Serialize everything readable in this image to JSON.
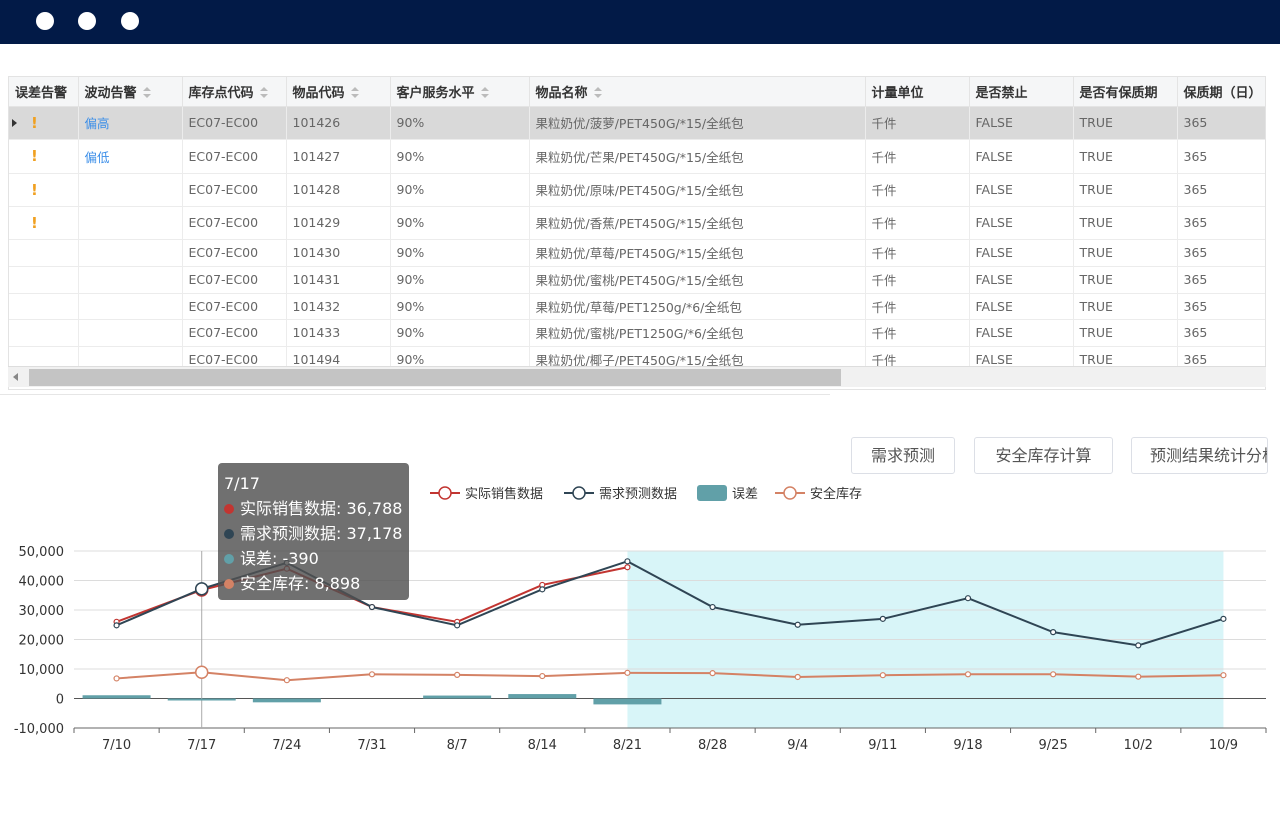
{
  "window": {
    "controls": [
      "circle",
      "circle",
      "circle"
    ]
  },
  "table": {
    "columns": [
      "误差告警",
      "波动告警",
      "库存点代码",
      "物品代码",
      "客户服务水平",
      "物品名称",
      "计量单位",
      "是否禁止",
      "是否有保质期",
      "保质期（日）"
    ],
    "rows": [
      [
        "!",
        "偏高",
        "EC07-EC00",
        "101426",
        "90%",
        "果粒奶优/菠萝/PET450G/*15/全纸包",
        "千件",
        "FALSE",
        "TRUE",
        "365"
      ],
      [
        "!",
        "偏低",
        "EC07-EC00",
        "101427",
        "90%",
        "果粒奶优/芒果/PET450G/*15/全纸包",
        "千件",
        "FALSE",
        "TRUE",
        "365"
      ],
      [
        "!",
        "",
        "EC07-EC00",
        "101428",
        "90%",
        "果粒奶优/原味/PET450G/*15/全纸包",
        "千件",
        "FALSE",
        "TRUE",
        "365"
      ],
      [
        "!",
        "",
        "EC07-EC00",
        "101429",
        "90%",
        "果粒奶优/香蕉/PET450G/*15/全纸包",
        "千件",
        "FALSE",
        "TRUE",
        "365"
      ],
      [
        "",
        "",
        "EC07-EC00",
        "101430",
        "90%",
        "果粒奶优/草莓/PET450G/*15/全纸包",
        "千件",
        "FALSE",
        "TRUE",
        "365"
      ],
      [
        "",
        "",
        "EC07-EC00",
        "101431",
        "90%",
        "果粒奶优/蜜桃/PET450G/*15/全纸包",
        "千件",
        "FALSE",
        "TRUE",
        "365"
      ],
      [
        "",
        "",
        "EC07-EC00",
        "101432",
        "90%",
        "果粒奶优/草莓/PET1250g/*6/全纸包",
        "千件",
        "FALSE",
        "TRUE",
        "365"
      ],
      [
        "",
        "",
        "EC07-EC00",
        "101433",
        "90%",
        "果粒奶优/蜜桃/PET1250G/*6/全纸包",
        "千件",
        "FALSE",
        "TRUE",
        "365"
      ],
      [
        "",
        "",
        "EC07-EC00",
        "101494",
        "90%",
        "果粒奶优/椰子/PET450G/*15/全纸包",
        "千件",
        "FALSE",
        "TRUE",
        "365"
      ]
    ]
  },
  "buttons": {
    "forecast": "需求预测",
    "safety_stock": "安全库存计算",
    "stats": "预测结果统计分析"
  },
  "tooltip": {
    "title": "7/17",
    "lines": [
      "实际销售数据: 36,788",
      "需求预测数据: 37,178",
      "误差: -390",
      "安全库存: 8,898"
    ]
  },
  "colors": {
    "actual": "#c23531",
    "forecast": "#2f4554",
    "error": "#61a0a8",
    "safety": "#d48265",
    "highlight": "#d8f5f8",
    "alert": "#f0a020",
    "link": "#3b8ee8"
  },
  "chart_data": {
    "type": "line",
    "categories": [
      "7/10",
      "7/17",
      "7/24",
      "7/31",
      "8/7",
      "8/14",
      "8/21",
      "8/28",
      "9/4",
      "9/11",
      "9/18",
      "9/25",
      "10/2",
      "10/9"
    ],
    "series": [
      {
        "name": "实际销售数据",
        "type": "line",
        "values": [
          26000,
          36788,
          44000,
          31000,
          26000,
          38500,
          44500,
          null,
          null,
          null,
          null,
          null,
          null,
          null
        ]
      },
      {
        "name": "需求预测数据",
        "type": "line",
        "values": [
          24800,
          37178,
          46000,
          31000,
          24800,
          37000,
          46500,
          31000,
          25000,
          27000,
          34000,
          22500,
          18000,
          27000
        ]
      },
      {
        "name": "误差",
        "type": "bar",
        "values": [
          1100,
          -390,
          -1300,
          0,
          1000,
          1500,
          -2000,
          0,
          0,
          0,
          0,
          0,
          0,
          0
        ]
      },
      {
        "name": "安全库存",
        "type": "line",
        "values": [
          6800,
          8898,
          6200,
          8200,
          8000,
          7600,
          8700,
          8600,
          7300,
          7900,
          8200,
          8200,
          7400,
          7900
        ]
      }
    ],
    "ylim": [
      -10000,
      50000
    ],
    "yticks": [
      "50,000",
      "40,000",
      "30,000",
      "20,000",
      "10,000",
      "0",
      "-10,000"
    ],
    "forecast_region": [
      "8/21",
      "10/9"
    ],
    "legend_position": "top",
    "grid": true
  }
}
